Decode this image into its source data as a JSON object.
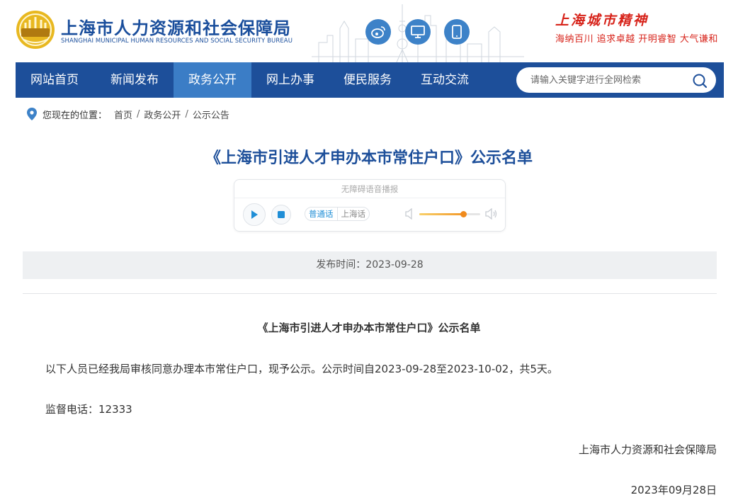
{
  "header": {
    "title": "上海市人力资源和社会保障局",
    "subtitle": "SHANGHAI MUNICIPAL HUMAN RESOURCES AND SOCIAL SECURITY BUREAU",
    "icons": [
      "weibo-icon",
      "desktop-icon",
      "mobile-icon"
    ],
    "spirit_title": "上海城市精神",
    "spirit_sub": "海纳百川  追求卓越  开明睿智  大气谦和"
  },
  "nav": {
    "items": [
      {
        "label": "网站首页"
      },
      {
        "label": "新闻发布"
      },
      {
        "label": "政务公开"
      },
      {
        "label": "网上办事"
      },
      {
        "label": "便民服务"
      },
      {
        "label": "互动交流"
      }
    ],
    "active_label": "政务公开",
    "search_placeholder": "请输入关键字进行全网检索"
  },
  "breadcrumb": {
    "prefix": "您现在的位置：",
    "items": [
      "首页",
      "政务公开",
      "公示公告"
    ],
    "separator": "/"
  },
  "article": {
    "title": "《上海市引进人才申办本市常住户口》公示名单",
    "player": {
      "header": "无障碍语音播报",
      "lang_selected": "普通话",
      "lang_other": "上海话",
      "volume_percent": 72
    },
    "publish": "发布时间：2023-09-28",
    "content_heading": "《上海市引进人才申办本市常住户口》公示名单",
    "paragraph1": "以下人员已经我局审核同意办理本市常住户口，现予公示。公示时间自2023-09-28至2023-10-02，共5天。",
    "paragraph2": "监督电话：12333",
    "signature": "上海市人力资源和社会保障局",
    "date": "2023年09月28日"
  },
  "colors": {
    "brand_blue": "#1d4f9a",
    "nav_active": "#3b7dc6",
    "accent_red": "#d7231a",
    "icon_blue": "#3d82c8"
  }
}
